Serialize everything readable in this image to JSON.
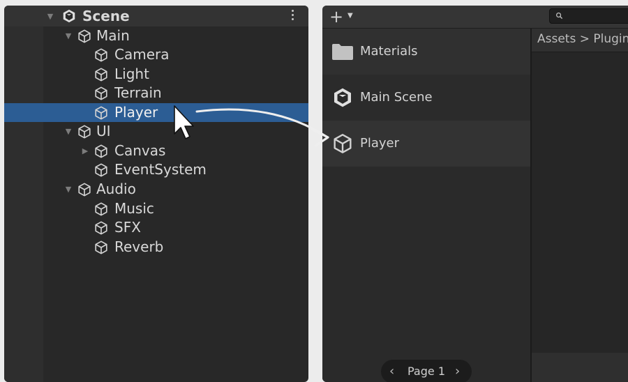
{
  "hierarchy": {
    "scene_label": "Scene",
    "items": [
      {
        "label": "Main",
        "expanded": true
      },
      {
        "label": "Camera"
      },
      {
        "label": "Light"
      },
      {
        "label": "Terrain"
      },
      {
        "label": "Player",
        "selected": true
      },
      {
        "label": "UI",
        "expanded": true
      },
      {
        "label": "Canvas",
        "collapsed": true
      },
      {
        "label": "EventSystem"
      },
      {
        "label": "Audio",
        "expanded": true
      },
      {
        "label": "Music"
      },
      {
        "label": "SFX"
      },
      {
        "label": "Reverb"
      }
    ]
  },
  "project": {
    "add_label": "+",
    "breadcrumb": "Assets > Plugin",
    "items": [
      {
        "label": "Materials",
        "icon": "folder-icon"
      },
      {
        "label": "Main Scene",
        "icon": "unity-scene-icon"
      },
      {
        "label": "Player",
        "icon": "prefab-cube-icon"
      }
    ],
    "pager": {
      "prev": "‹",
      "label": "Page 1",
      "next": "›"
    }
  },
  "colors": {
    "panel_bg": "#282828",
    "selection": "#2c5d94",
    "text": "#d8d8d8"
  }
}
